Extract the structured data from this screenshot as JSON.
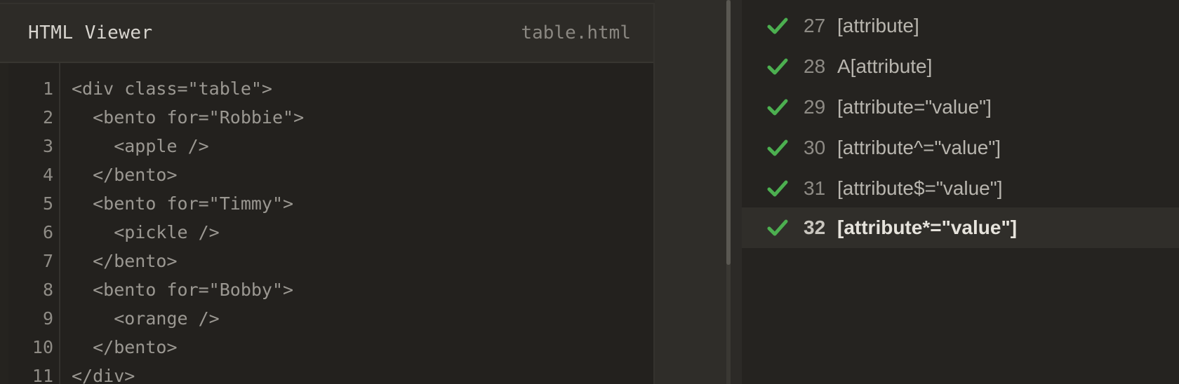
{
  "viewer": {
    "title": "HTML Viewer",
    "filename": "table.html"
  },
  "code": {
    "lines": [
      {
        "num": "1",
        "text": "<div class=\"table\">"
      },
      {
        "num": "2",
        "text": "  <bento for=\"Robbie\">"
      },
      {
        "num": "3",
        "text": "    <apple />"
      },
      {
        "num": "4",
        "text": "  </bento>"
      },
      {
        "num": "5",
        "text": "  <bento for=\"Timmy\">"
      },
      {
        "num": "6",
        "text": "    <pickle />"
      },
      {
        "num": "7",
        "text": "  </bento>"
      },
      {
        "num": "8",
        "text": "  <bento for=\"Bobby\">"
      },
      {
        "num": "9",
        "text": "    <orange />"
      },
      {
        "num": "10",
        "text": "  </bento>"
      },
      {
        "num": "11",
        "text": "</div>"
      }
    ]
  },
  "levels": {
    "items": [
      {
        "num": "27",
        "name": "[attribute]",
        "completed": true,
        "active": false
      },
      {
        "num": "28",
        "name": "A[attribute]",
        "completed": true,
        "active": false
      },
      {
        "num": "29",
        "name": "[attribute=\"value\"]",
        "completed": true,
        "active": false
      },
      {
        "num": "30",
        "name": "[attribute^=\"value\"]",
        "completed": true,
        "active": false
      },
      {
        "num": "31",
        "name": "[attribute$=\"value\"]",
        "completed": true,
        "active": false
      },
      {
        "num": "32",
        "name": "[attribute*=\"value\"]",
        "completed": true,
        "active": true
      }
    ]
  },
  "colors": {
    "check": "#4caf50",
    "background": "#252320"
  },
  "icons": {
    "check": "checkmark-icon"
  }
}
